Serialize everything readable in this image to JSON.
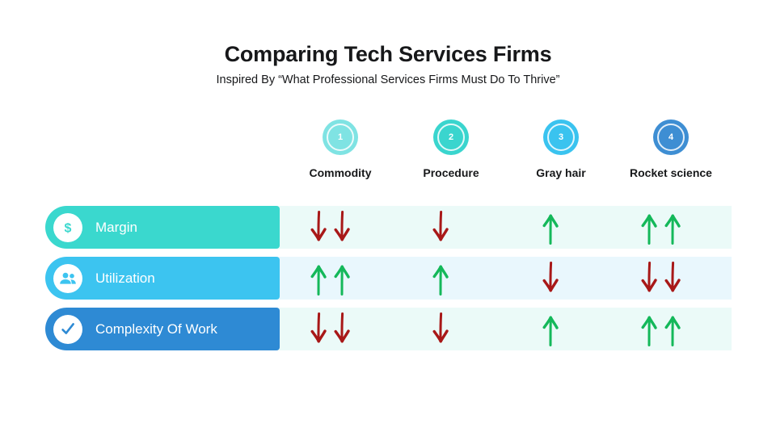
{
  "header": {
    "title": "Comparing Tech Services Firms",
    "subtitle": "Inspired By “What Professional Services Firms Must Do To Thrive”"
  },
  "columns": [
    {
      "number": "1",
      "label": "Commodity",
      "color": "#7FE3E3"
    },
    {
      "number": "2",
      "label": "Procedure",
      "color": "#3AD5CE"
    },
    {
      "number": "3",
      "label": "Gray hair",
      "color": "#3AC3EF"
    },
    {
      "number": "4",
      "label": "Rocket science",
      "color": "#3E8ED3"
    }
  ],
  "rows": [
    {
      "label": "Margin",
      "icon": "dollar-icon",
      "color": "#3AD8CE",
      "band": "#EBFAF8",
      "cells": [
        {
          "direction": "down",
          "count": 2
        },
        {
          "direction": "down",
          "count": 1
        },
        {
          "direction": "up",
          "count": 1
        },
        {
          "direction": "up",
          "count": 2
        }
      ]
    },
    {
      "label": "Utilization",
      "icon": "people-icon",
      "color": "#3CC4F0",
      "band": "#E9F7FD",
      "cells": [
        {
          "direction": "up",
          "count": 2
        },
        {
          "direction": "up",
          "count": 1
        },
        {
          "direction": "down",
          "count": 1
        },
        {
          "direction": "down",
          "count": 2
        }
      ]
    },
    {
      "label": "Complexity Of Work",
      "icon": "check-icon",
      "color": "#2E8AD4",
      "band": "#EBFAF8",
      "cells": [
        {
          "direction": "down",
          "count": 2
        },
        {
          "direction": "down",
          "count": 1
        },
        {
          "direction": "up",
          "count": 1
        },
        {
          "direction": "up",
          "count": 2
        }
      ]
    }
  ],
  "colors": {
    "arrow_up": "#14B85A",
    "arrow_down": "#A81818",
    "text_dark": "#17181a"
  }
}
